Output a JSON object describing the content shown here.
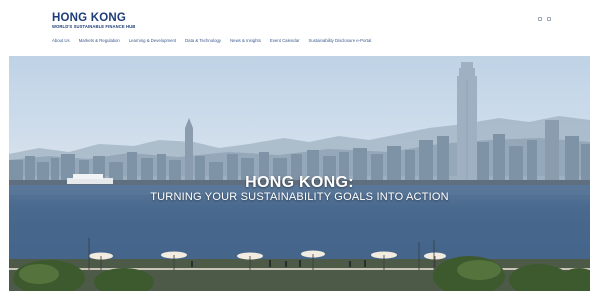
{
  "header": {
    "logo_title": "HONG KONG",
    "logo_subtitle": "WORLD'S SUSTAINABLE FINANCE HUB",
    "nav": [
      "About Us",
      "Markets & Regulation",
      "Learning & Development",
      "Data & Technology",
      "News & Insights",
      "Event Calendar",
      "Sustainability Disclosure e-Portal"
    ],
    "icons": [
      "search-icon",
      "menu-icon"
    ]
  },
  "hero": {
    "title": "HONG KONG:",
    "subtitle": "TURNING YOUR SUSTAINABILITY GOALS INTO ACTION"
  },
  "colors": {
    "brand_navy": "#1d3c78",
    "nav_text": "#3b5a8c",
    "sky": "#cddceb",
    "harbour": "#3e5f88"
  }
}
